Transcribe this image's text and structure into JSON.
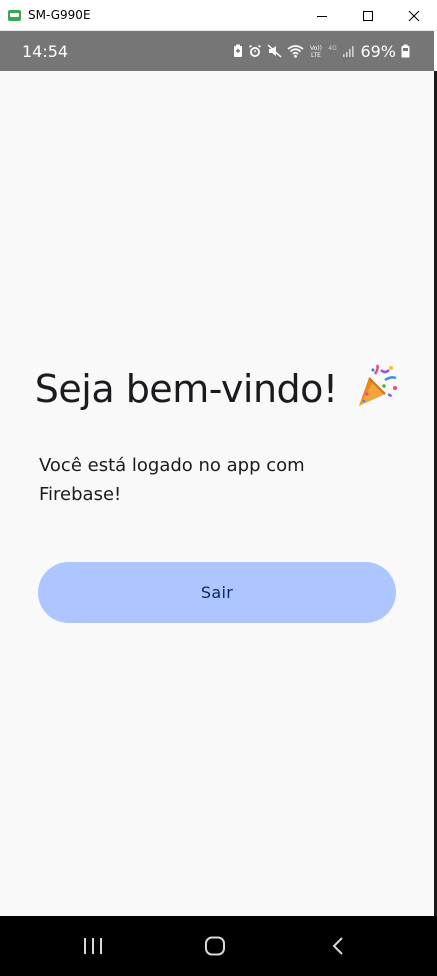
{
  "window": {
    "title": "SM-G990E",
    "icon": "android-app-icon",
    "controls": [
      "minimize-icon",
      "maximize-icon",
      "close-icon"
    ]
  },
  "status_bar": {
    "time": "14:54",
    "battery_percent": "69%",
    "network_small": "4G",
    "volte": "VoLTE"
  },
  "app": {
    "welcome_title": "Seja bem-vindo!",
    "welcome_emoji_icon": "party-popper-icon",
    "message": "Você está logado no app com Firebase!",
    "logout_label": "Sair",
    "button_color": "#adc6ff",
    "background_color": "#f9f9f9"
  },
  "nav_bar": {
    "buttons": [
      "recents-icon",
      "home-icon",
      "back-icon"
    ]
  }
}
